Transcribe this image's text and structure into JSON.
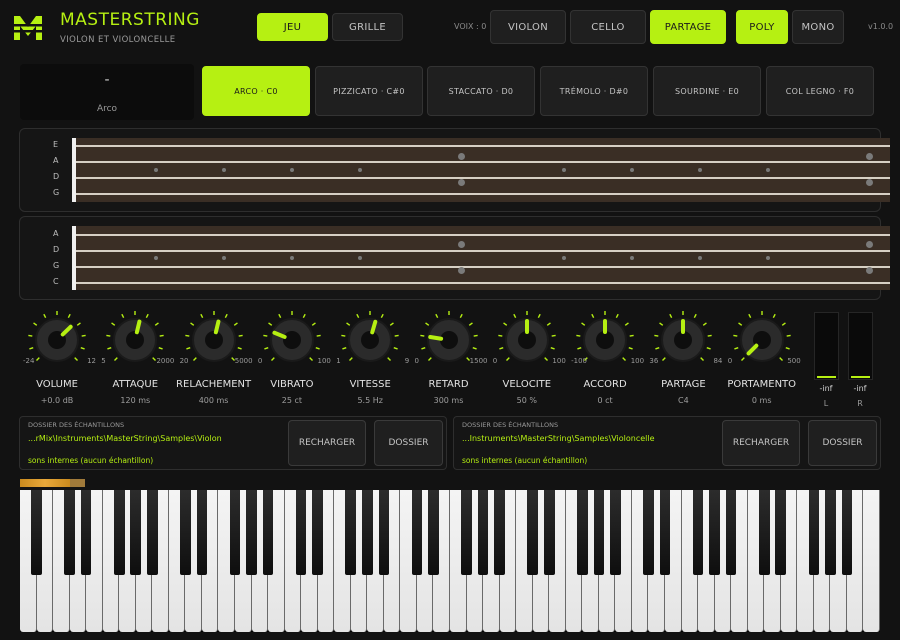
{
  "header": {
    "brand": "MASTERSTRING",
    "subtitle": "VIOLON ET VIOLONCELLE",
    "tabs": [
      {
        "label": "JEU",
        "active": true
      },
      {
        "label": "GRILLE",
        "active": false
      }
    ],
    "voices_label": "VOIX : 0",
    "instruments": [
      {
        "label": "VIOLON",
        "active": false
      },
      {
        "label": "CELLO",
        "active": false
      },
      {
        "label": "PARTAGE",
        "active": true
      }
    ],
    "modes": [
      {
        "label": "POLY",
        "active": true
      },
      {
        "label": "MONO",
        "active": false
      }
    ],
    "version": "v1.0.0",
    "accent_color": "#b6f012",
    "logo_icon": "masterstring-m-logo"
  },
  "articulation": {
    "current_value": "-",
    "current_name": "Arco",
    "buttons": [
      {
        "label": "ARCO · C0",
        "active": true
      },
      {
        "label": "PIZZICATO · C#0",
        "active": false
      },
      {
        "label": "STACCATO · D0",
        "active": false
      },
      {
        "label": "TRÉMOLO · D#0",
        "active": false
      },
      {
        "label": "SOURDINE · E0",
        "active": false
      },
      {
        "label": "COL LEGNO · F0",
        "active": false
      }
    ]
  },
  "violin_board": {
    "strings": [
      "E",
      "A",
      "D",
      "G"
    ]
  },
  "cello_board": {
    "strings": [
      "A",
      "D",
      "G",
      "C"
    ]
  },
  "knobs": [
    {
      "label": "VOLUME",
      "value": "+0.0 dB",
      "min": "-24",
      "max": "12",
      "level": 0.67
    },
    {
      "label": "ATTAQUE",
      "value": "120 ms",
      "min": "5",
      "max": "2000",
      "level": 0.55
    },
    {
      "label": "RELACHEMENT",
      "value": "400 ms",
      "min": "20",
      "max": "5000",
      "level": 0.55
    },
    {
      "label": "VIBRATO",
      "value": "25 ct",
      "min": "0",
      "max": "100",
      "level": 0.25
    },
    {
      "label": "VITESSE",
      "value": "5.5 Hz",
      "min": "1",
      "max": "9",
      "level": 0.56
    },
    {
      "label": "RETARD",
      "value": "300 ms",
      "min": "0",
      "max": "1500",
      "level": 0.2
    },
    {
      "label": "VELOCITE",
      "value": "50 %",
      "min": "0",
      "max": "100",
      "level": 0.5
    },
    {
      "label": "ACCORD",
      "value": "0 ct",
      "min": "-100",
      "max": "100",
      "level": 0.5
    },
    {
      "label": "PARTAGE",
      "value": "C4",
      "min": "36",
      "max": "84",
      "level": 0.5
    },
    {
      "label": "PORTAMENTO",
      "value": "0 ms",
      "min": "0",
      "max": "500",
      "level": 0.0
    }
  ],
  "meters": [
    {
      "value": "-inf",
      "channel": "L"
    },
    {
      "value": "-inf",
      "channel": "R"
    }
  ],
  "sample_folders": [
    {
      "title": "DOSSIER DES ÉCHANTILLONS",
      "path": "...rMix\\Instruments\\MasterString\\Samples\\Violon",
      "status": "sons internes (aucun échantillon)",
      "reload_label": "RECHARGER",
      "folder_label": "DOSSIER"
    },
    {
      "title": "DOSSIER DES ÉCHANTILLONS",
      "path": "...Instruments\\MasterString\\Samples\\Violoncelle",
      "status": "sons internes (aucun échantillon)",
      "reload_label": "RECHARGER",
      "folder_label": "DOSSIER"
    }
  ]
}
